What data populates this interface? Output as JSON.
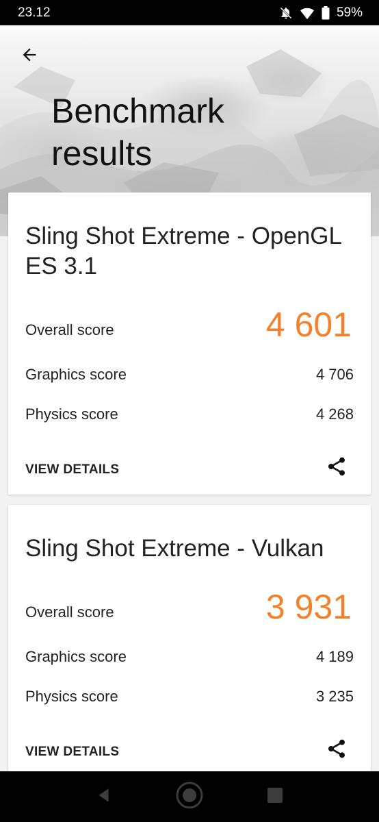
{
  "status_bar": {
    "time": "23.12",
    "battery": "59%",
    "icons": [
      "notifications-off-icon",
      "wifi-icon",
      "battery-icon"
    ]
  },
  "header": {
    "title": "Benchmark results",
    "back_icon": "arrow-back-icon"
  },
  "colors": {
    "accent": "#f5802a",
    "text": "#222222",
    "card_bg": "#ffffff",
    "background": "#f2f2f2"
  },
  "results": [
    {
      "title": "Sling Shot Extreme - OpenGL ES 3.1",
      "overall_label": "Overall score",
      "overall_value": "4 601",
      "graphics_label": "Graphics score",
      "graphics_value": "4 706",
      "physics_label": "Physics score",
      "physics_value": "4 268",
      "view_details": "VIEW DETAILS",
      "share_icon": "share-icon"
    },
    {
      "title": "Sling Shot Extreme - Vulkan",
      "overall_label": "Overall score",
      "overall_value": "3 931",
      "graphics_label": "Graphics score",
      "graphics_value": "4 189",
      "physics_label": "Physics score",
      "physics_value": "3 235",
      "view_details": "VIEW DETAILS",
      "share_icon": "share-icon"
    }
  ],
  "nav_bar": {
    "icons": [
      "nav-back-icon",
      "nav-home-icon",
      "nav-recents-icon"
    ]
  }
}
